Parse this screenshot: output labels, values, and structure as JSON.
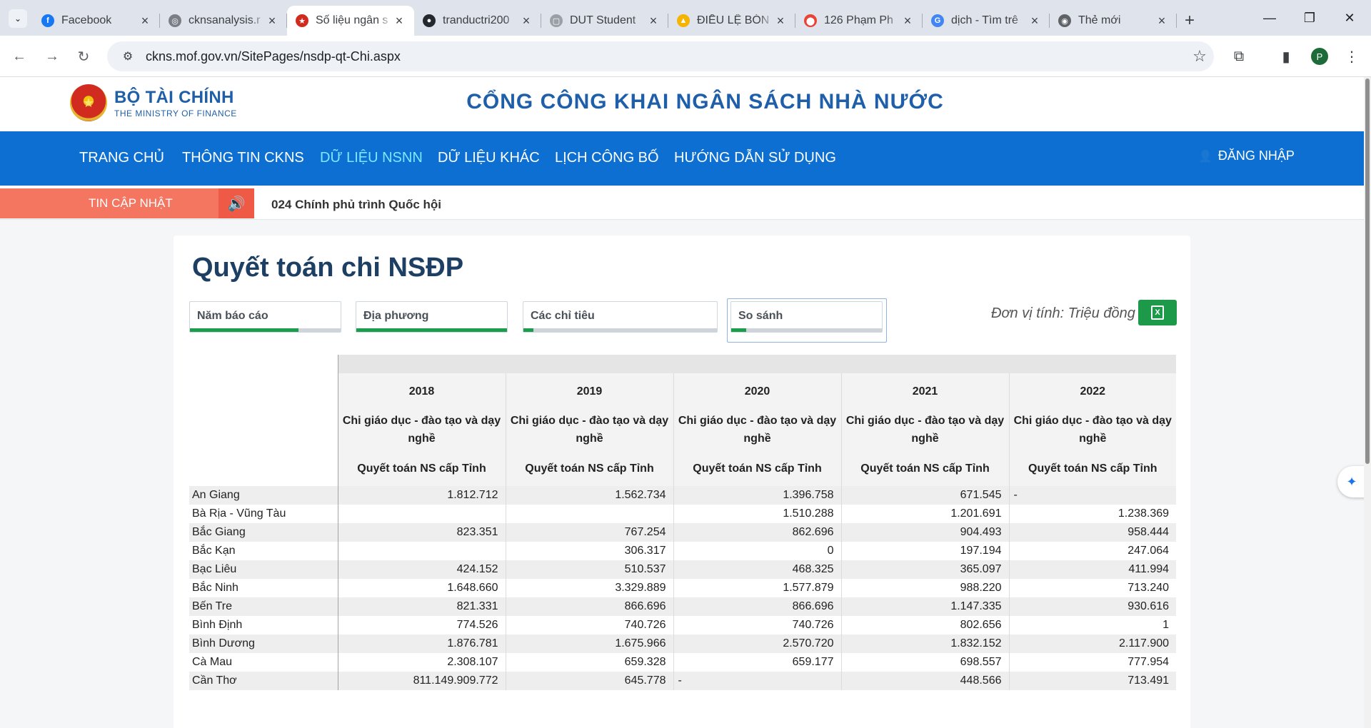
{
  "browser": {
    "tabs": [
      {
        "title": "Facebook",
        "icon": "facebook-icon",
        "color": "#1877f2",
        "glyph": "f"
      },
      {
        "title": "cknsanalysis.r",
        "icon": "globe-icon",
        "color": "#7a7f87",
        "glyph": "◎"
      },
      {
        "title": "Số liệu ngân s",
        "icon": "emblem-icon",
        "color": "#d12b1f",
        "glyph": "★",
        "active": true
      },
      {
        "title": "tranductri200",
        "icon": "github-icon",
        "color": "#24292f",
        "glyph": "●"
      },
      {
        "title": "DUT Student",
        "icon": "page-icon",
        "color": "#9aa0a6",
        "glyph": "▢"
      },
      {
        "title": "ĐIỀU LỆ BÓN",
        "icon": "drive-icon",
        "color": "#f4b400",
        "glyph": "▲"
      },
      {
        "title": "126 Phạm Ph",
        "icon": "maps-icon",
        "color": "#ea4335",
        "glyph": "⬤"
      },
      {
        "title": "dịch - Tìm trê",
        "icon": "google-icon",
        "color": "#4285f4",
        "glyph": "G"
      },
      {
        "title": "Thẻ mới",
        "icon": "chrome-icon",
        "color": "#5f6368",
        "glyph": "◉"
      }
    ],
    "new_tab": "+",
    "url": "ckns.mof.gov.vn/SitePages/nsdp-qt-Chi.aspx",
    "profile_initial": "P"
  },
  "site": {
    "logo_main": "BỘ TÀI CHÍNH",
    "logo_sub": "THE MINISTRY OF FINANCE",
    "title": "CỔNG CÔNG KHAI NGÂN SÁCH NHÀ NƯỚC",
    "nav": [
      "TRANG CHỦ",
      "THÔNG TIN CKNS",
      "DỮ LIỆU NSNN",
      "DỮ LIỆU KHÁC",
      "LỊCH CÔNG BỐ",
      "HƯỚNG DẪN SỬ DỤNG"
    ],
    "login": "ĐĂNG NHẬP",
    "ticker_label": "TIN CẬP NHẬT",
    "ticker_text": "024 Chính phủ trình Quốc hội"
  },
  "report": {
    "title": "Quyết toán chi NSĐP",
    "filters": [
      {
        "label": "Năm báo cáo",
        "progress": 0.72
      },
      {
        "label": "Địa phương",
        "progress": 1.0
      },
      {
        "label": "Các chỉ tiêu",
        "progress": 0.05
      },
      {
        "label": "So sánh",
        "progress": 0.1
      }
    ],
    "unit": "Đơn vị tính: Triệu đồng",
    "columns": [
      {
        "year": "2018",
        "category": "Chi giáo dục - đào tạo và dạy nghề",
        "sub": "Quyết toán NS cấp Tỉnh"
      },
      {
        "year": "2019",
        "category": "Chi giáo dục - đào tạo và dạy nghề",
        "sub": "Quyết toán NS cấp Tỉnh"
      },
      {
        "year": "2020",
        "category": "Chi giáo dục - đào tạo và dạy nghề",
        "sub": "Quyết toán NS cấp Tỉnh"
      },
      {
        "year": "2021",
        "category": "Chi giáo dục - đào tạo và dạy nghề",
        "sub": "Quyết toán NS cấp Tỉnh"
      },
      {
        "year": "2022",
        "category": "Chi giáo dục - đào tạo và dạy nghề",
        "sub": "Quyết toán NS cấp Tỉnh"
      }
    ],
    "rows": [
      {
        "province": "An Giang",
        "values": [
          "1.812.712",
          "1.562.734",
          "1.396.758",
          "671.545",
          "-"
        ]
      },
      {
        "province": "Bà Rịa - Vũng Tàu",
        "values": [
          "",
          "",
          "1.510.288",
          "1.201.691",
          "1.238.369"
        ]
      },
      {
        "province": "Bắc Giang",
        "values": [
          "823.351",
          "767.254",
          "862.696",
          "904.493",
          "958.444"
        ]
      },
      {
        "province": "Bắc Kạn",
        "values": [
          "",
          "306.317",
          "0",
          "197.194",
          "247.064"
        ]
      },
      {
        "province": "Bạc Liêu",
        "values": [
          "424.152",
          "510.537",
          "468.325",
          "365.097",
          "411.994"
        ]
      },
      {
        "province": "Bắc Ninh",
        "values": [
          "1.648.660",
          "3.329.889",
          "1.577.879",
          "988.220",
          "713.240"
        ]
      },
      {
        "province": "Bến Tre",
        "values": [
          "821.331",
          "866.696",
          "866.696",
          "1.147.335",
          "930.616"
        ]
      },
      {
        "province": "Bình Định",
        "values": [
          "774.526",
          "740.726",
          "740.726",
          "802.656",
          "1"
        ]
      },
      {
        "province": "Bình Dương",
        "values": [
          "1.876.781",
          "1.675.966",
          "2.570.720",
          "1.832.152",
          "2.117.900"
        ]
      },
      {
        "province": "Cà Mau",
        "values": [
          "2.308.107",
          "659.328",
          "659.177",
          "698.557",
          "777.954"
        ]
      },
      {
        "province": "Cần Thơ",
        "values": [
          "811.149.909.772",
          "645.778",
          "-",
          "448.566",
          "713.491"
        ]
      }
    ]
  },
  "colors": {
    "nav_bg": "#0d6fd1",
    "nav_active": "#7ee8ff",
    "title_blue": "#1f5fa9",
    "ticker_label_bg": "#f47560",
    "progress_green": "#1b9e4b",
    "excel_green": "#1c9a4a"
  }
}
